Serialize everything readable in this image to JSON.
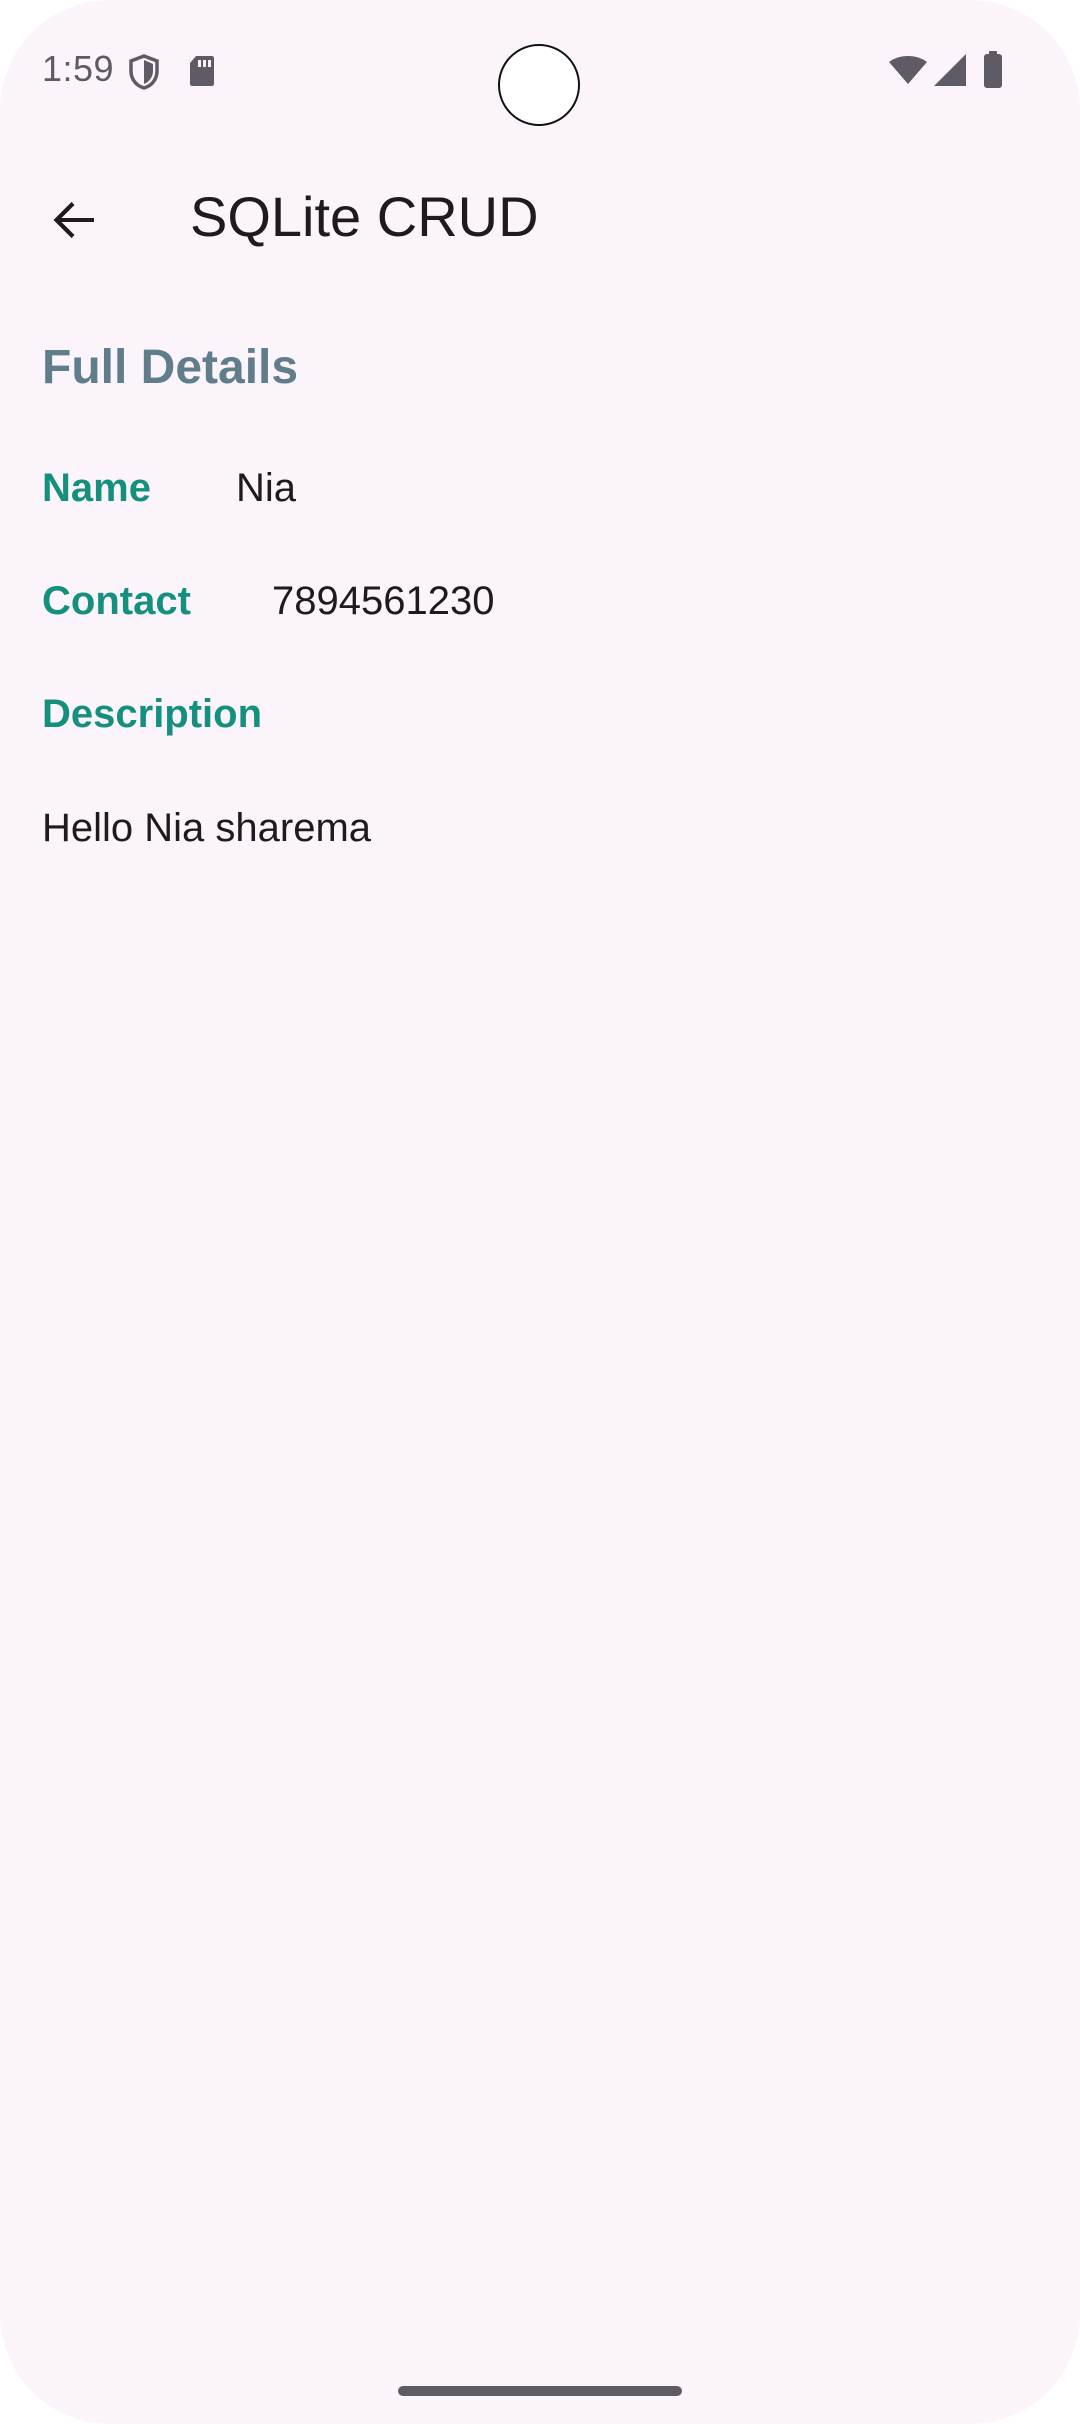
{
  "status_bar": {
    "time": "1:59",
    "icons": [
      "shield-icon",
      "sd-card-icon",
      "wifi-icon",
      "cell-signal-icon",
      "battery-icon"
    ]
  },
  "app_bar": {
    "title": "SQLite CRUD",
    "back_icon": "arrow-back-icon"
  },
  "details": {
    "heading": "Full Details",
    "name_label": "Name",
    "name_value": "Nia",
    "contact_label": "Contact",
    "contact_value": "7894561230",
    "description_label": "Description",
    "description_value": "Hello Nia sharema"
  },
  "colors": {
    "background": "#fcf4fb",
    "heading": "#5f7d8b",
    "label_accent": "#15907f",
    "text": "#1d1b20"
  }
}
